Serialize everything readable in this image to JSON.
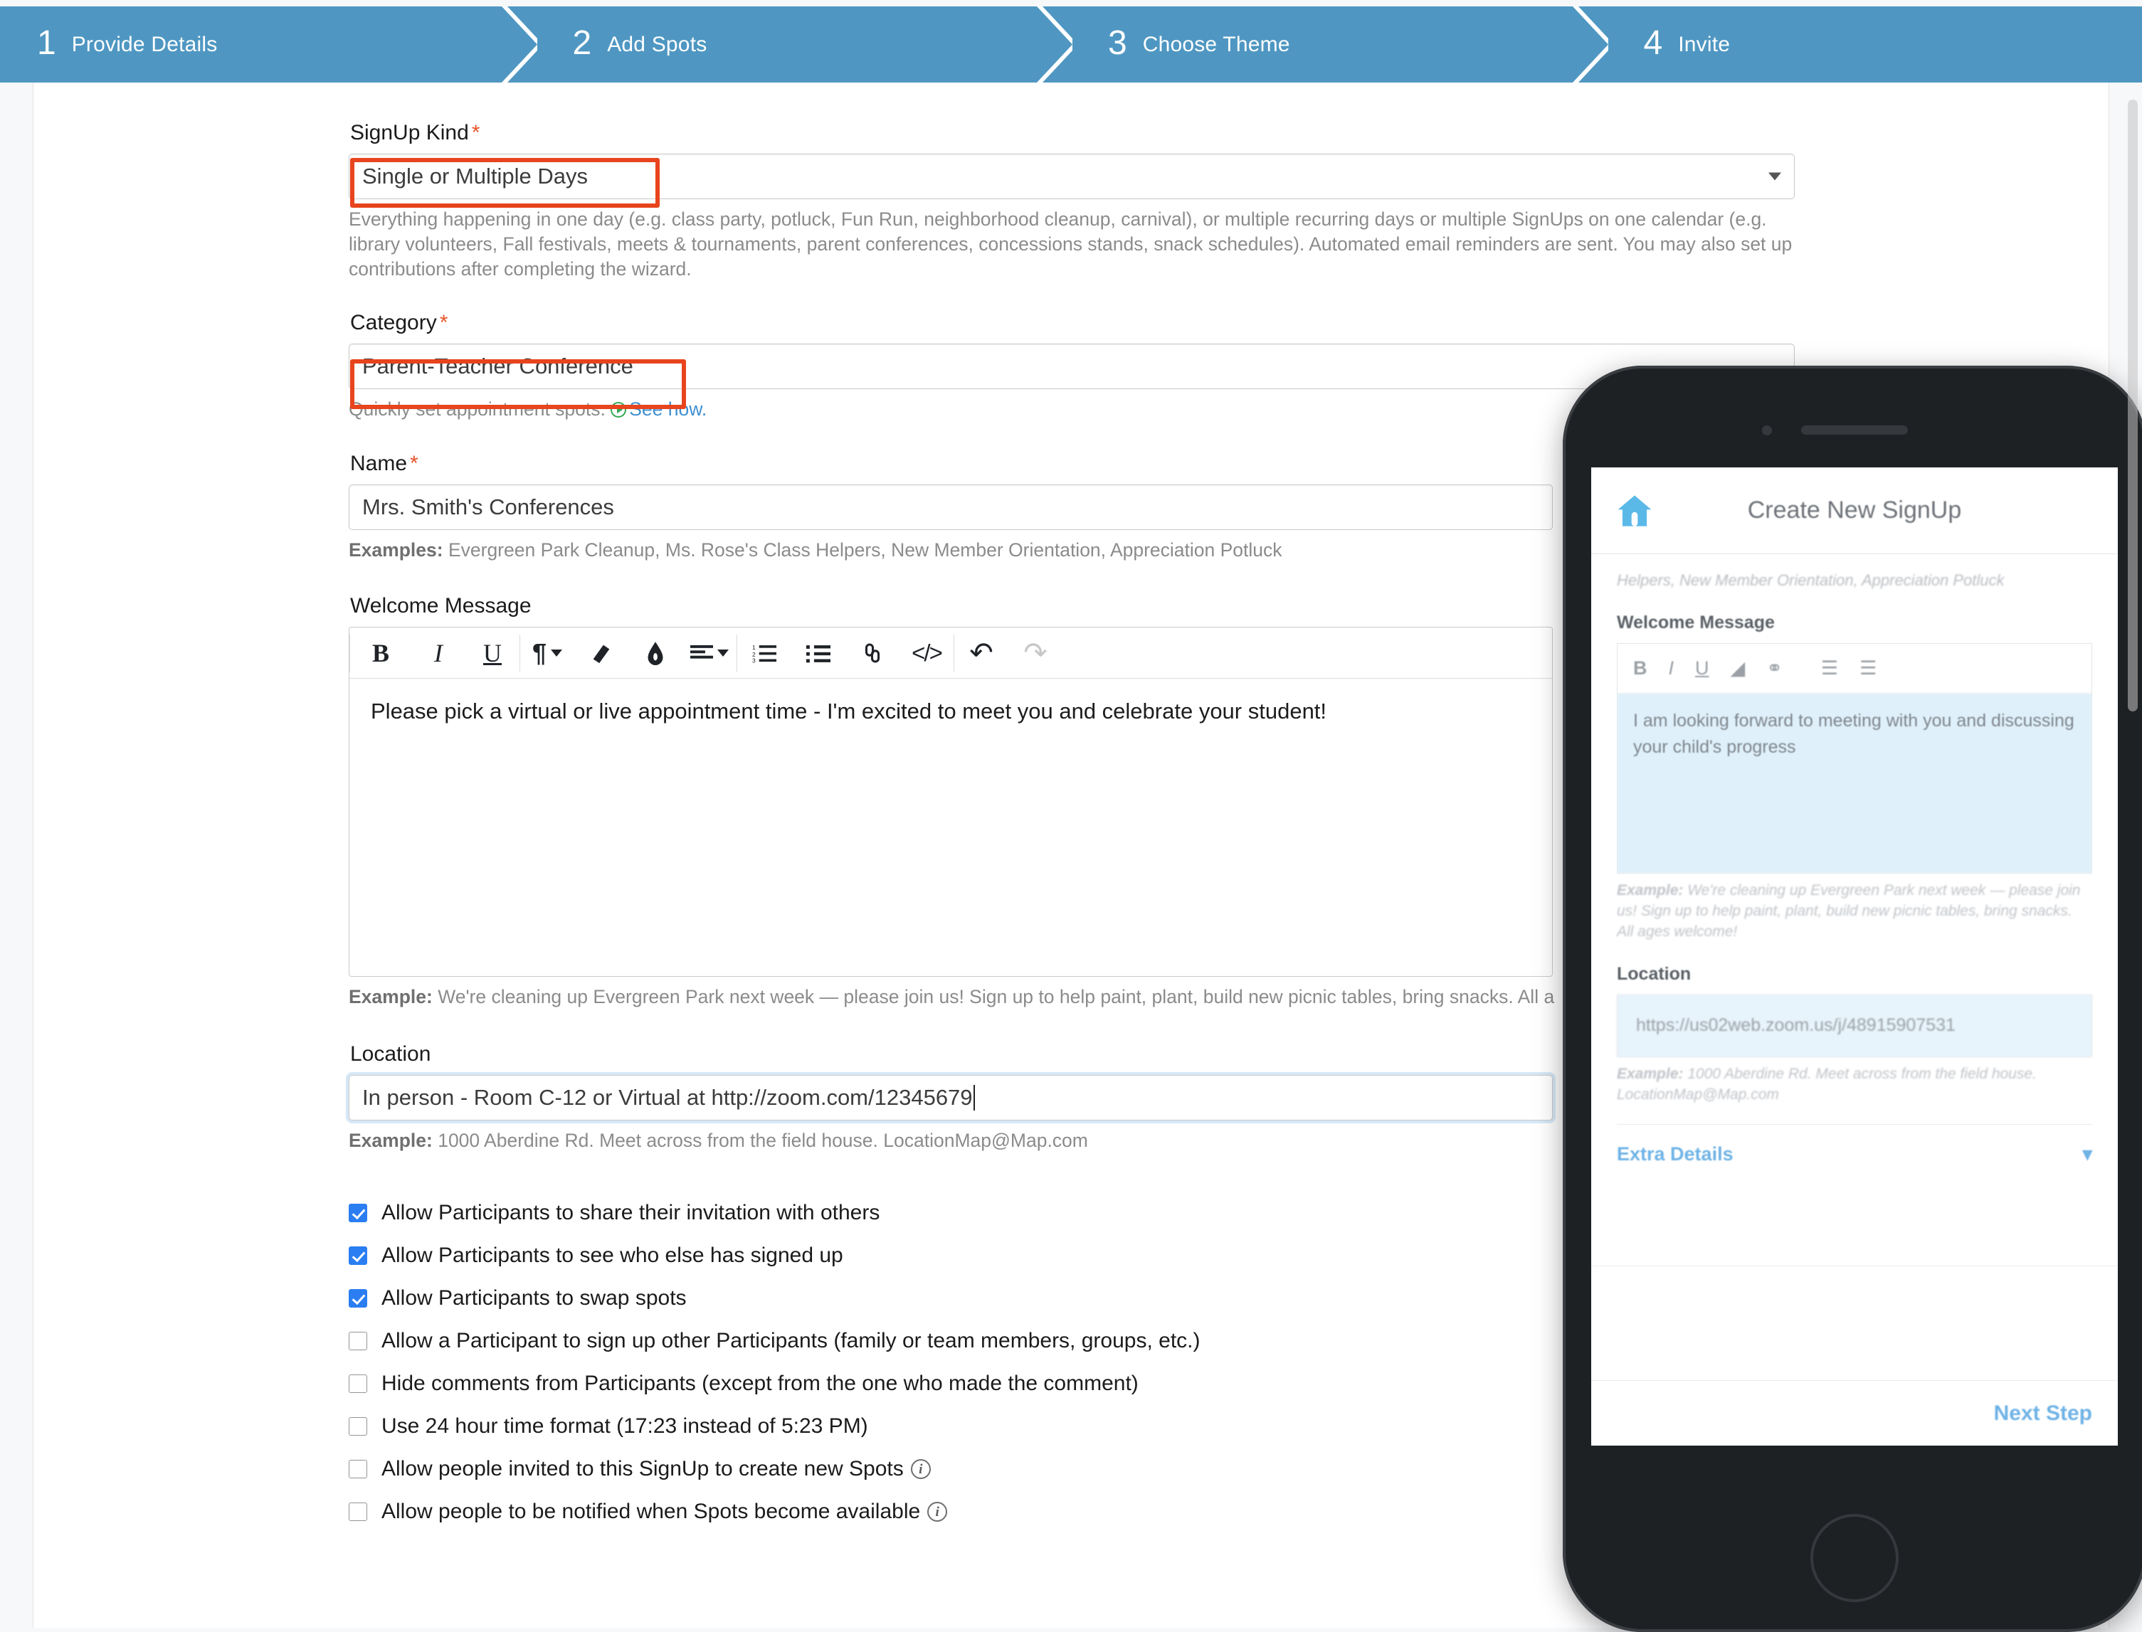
{
  "wizard": {
    "steps": [
      {
        "num": "1",
        "label": "Provide Details"
      },
      {
        "num": "2",
        "label": "Add Spots"
      },
      {
        "num": "3",
        "label": "Choose Theme"
      },
      {
        "num": "4",
        "label": "Invite"
      }
    ],
    "active_color": "#4f97c2"
  },
  "form": {
    "signup_kind": {
      "label": "SignUp Kind",
      "required_mark": "*",
      "value": "Single or Multiple Days",
      "help": "Everything happening in one day (e.g. class party, potluck, Fun Run, neighborhood cleanup, carnival), or multiple recurring days or multiple SignUps on one calendar (e.g. library volunteers, Fall festivals, meets & tournaments, parent conferences, concessions stands, snack schedules). Automated email reminders are sent. You may also set up contributions after completing the wizard."
    },
    "category": {
      "label": "Category",
      "required_mark": "*",
      "value": "Parent-Teacher Conference",
      "help_prefix": "Quickly set appointment spots.",
      "help_link": "See how."
    },
    "name": {
      "label": "Name",
      "required_mark": "*",
      "value": "Mrs. Smith's Conferences",
      "examples_label": "Examples:",
      "examples_text": "Evergreen Park Cleanup, Ms. Rose's Class Helpers, New Member Orientation, Appreciation Potluck"
    },
    "welcome_message": {
      "label": "Welcome Message",
      "value": "Please pick a virtual or live appointment time - I'm excited to meet you and celebrate your student!",
      "example_label": "Example:",
      "example_text": "We're cleaning up Evergreen Park next week — please join us! Sign up to help paint, plant, build new picnic tables, bring snacks. All a",
      "toolbar": [
        {
          "name": "bold-icon",
          "glyph": "B"
        },
        {
          "name": "italic-icon",
          "glyph": "I"
        },
        {
          "name": "underline-icon",
          "glyph": "U"
        },
        {
          "name": "paragraph-format-icon",
          "glyph": "¶"
        },
        {
          "name": "text-highlight-icon",
          "glyph": "▰"
        },
        {
          "name": "text-color-icon",
          "glyph": "❦"
        },
        {
          "name": "align-icon",
          "glyph": "☰"
        },
        {
          "name": "ordered-list-icon",
          "glyph": "≡"
        },
        {
          "name": "unordered-list-icon",
          "glyph": "≣"
        },
        {
          "name": "insert-link-icon",
          "glyph": "⚭"
        },
        {
          "name": "code-view-icon",
          "glyph": "‹›"
        },
        {
          "name": "undo-icon",
          "glyph": "↺"
        },
        {
          "name": "redo-icon",
          "glyph": "↻"
        }
      ]
    },
    "location": {
      "label": "Location",
      "value": "In person - Room C-12 or Virtual at http://zoom.com/12345679",
      "example_label": "Example:",
      "example_text": "1000 Aberdine Rd. Meet across from the field house. LocationMap@Map.com"
    },
    "options": [
      {
        "label": "Allow Participants to share their invitation with others",
        "checked": true,
        "info": false
      },
      {
        "label": "Allow Participants to see who else has signed up",
        "checked": true,
        "info": false
      },
      {
        "label": "Allow Participants to swap spots",
        "checked": true,
        "info": false
      },
      {
        "label": "Allow a Participant to sign up other Participants (family or team members, groups, etc.)",
        "checked": false,
        "info": false
      },
      {
        "label": "Hide comments from Participants (except from the one who made the comment)",
        "checked": false,
        "info": false
      },
      {
        "label": "Use 24 hour time format (17:23 instead of 5:23 PM)",
        "checked": false,
        "info": false
      },
      {
        "label": "Allow people invited to this SignUp to create new Spots",
        "checked": false,
        "info": true
      },
      {
        "label": "Allow people to be notified when Spots become available",
        "checked": false,
        "info": true
      }
    ]
  },
  "phone": {
    "title": "Create New SignUp",
    "faint_top": "Helpers, New Member Orientation, Appreciation Potluck",
    "welcome_label": "Welcome Message",
    "welcome_text": "I am looking forward to meeting with you and discussing your child's progress",
    "welcome_example_label": "Example:",
    "welcome_example_text": "We're cleaning up Evergreen Park next week — please join us! Sign up to help paint, plant, build new picnic tables, bring snacks. All ages welcome!",
    "location_label": "Location",
    "location_value": "https://us02web.zoom.us/j/48915907531",
    "location_example_label": "Example:",
    "location_example_text": "1000 Aberdine Rd. Meet across from the field house. LocationMap@Map.com",
    "extra_details_label": "Extra Details",
    "next_step_label": "Next Step",
    "toolbar_icons": [
      "bold-icon",
      "italic-icon",
      "underline-icon",
      "text-color-icon",
      "insert-link-icon",
      "ordered-list-icon",
      "unordered-list-icon"
    ]
  },
  "highlight_color": "#e8441d"
}
